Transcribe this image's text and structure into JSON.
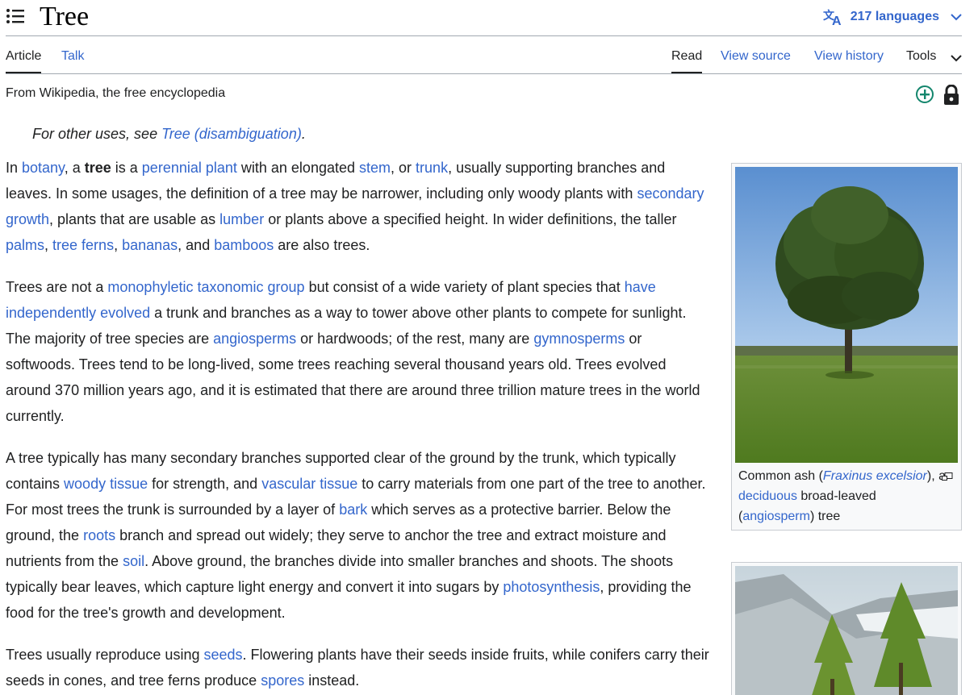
{
  "header": {
    "title": "Tree",
    "languages_label": "217 languages"
  },
  "tabs": {
    "article": "Article",
    "talk": "Talk",
    "read": "Read",
    "view_source": "View source",
    "view_history": "View history",
    "tools": "Tools"
  },
  "tagline": "From Wikipedia, the free encyclopedia",
  "hatnote": {
    "prefix": "For other uses, see ",
    "link": "Tree (disambiguation)",
    "suffix": "."
  },
  "paragraphs": {
    "p1": {
      "s0": "In ",
      "l0": "botany",
      "s1": ", a ",
      "b0": "tree",
      "s2": " is a ",
      "l1": "perennial plant",
      "s3": " with an elongated ",
      "l2": "stem",
      "s4": ", or ",
      "l3": "trunk",
      "s5": ", usually supporting branches and leaves. In some usages, the definition of a tree may be narrower, including only woody plants with ",
      "l4": "secondary growth",
      "s6": ", plants that are usable as ",
      "l5": "lumber",
      "s7": " or plants above a specified height. In wider definitions, the taller ",
      "l6": "palms",
      "s8": ", ",
      "l7": "tree ferns",
      "s9": ", ",
      "l8": "bananas",
      "s10": ", and ",
      "l9": "bamboos",
      "s11": " are also trees."
    },
    "p2": {
      "s0": "Trees are not a ",
      "l0": "monophyletic",
      "s1": " ",
      "l1": "taxonomic group",
      "s2": " but consist of a wide variety of plant species that ",
      "l2": "have independently evolved",
      "s3": " a trunk and branches as a way to tower above other plants to compete for sunlight. The majority of tree species are ",
      "l3": "angiosperms",
      "s4": " or hardwoods; of the rest, many are ",
      "l4": "gymnosperms",
      "s5": " or softwoods. Trees tend to be long-lived, some trees reaching several thousand years old. Trees evolved around 370 million years ago, and it is estimated that there are around three trillion mature trees in the world currently."
    },
    "p3": {
      "s0": "A tree typically has many secondary branches supported clear of the ground by the trunk, which typically contains ",
      "l0": "woody tissue",
      "s1": " for strength, and ",
      "l1": "vascular tissue",
      "s2": " to carry materials from one part of the tree to another. For most trees the trunk is surrounded by a layer of ",
      "l2": "bark",
      "s3": " which serves as a protective barrier. Below the ground, the ",
      "l3": "roots",
      "s4": " branch and spread out widely; they serve to anchor the tree and extract moisture and nutrients from the ",
      "l4": "soil",
      "s5": ". Above ground, the branches divide into smaller branches and shoots. The shoots typically bear leaves, which capture light energy and convert it into sugars by ",
      "l5": "photosynthesis",
      "s6": ", providing the food for the tree's growth and development."
    },
    "p4": {
      "s0": "Trees usually reproduce using ",
      "l0": "seeds",
      "s1": ". Flowering plants have their seeds inside fruits, while conifers carry their seeds in cones, and tree ferns produce ",
      "l1": "spores",
      "s2": " instead."
    }
  },
  "figure1": {
    "c0": "Common ash (",
    "l0": "Fraxinus excelsior",
    "c1": "), a ",
    "l1": "deciduous",
    "c2": " broad-leaved (",
    "l2": "angiosperm",
    "c3": ") tree"
  },
  "colors": {
    "link": "#3366cc",
    "text": "#202122",
    "border": "#a2a9b1",
    "watch_green": "#14866d"
  },
  "icons": [
    "toc-icon",
    "translate-icon",
    "chevron-down-icon",
    "watch-plus-icon",
    "lock-icon",
    "enlarge-icon"
  ]
}
